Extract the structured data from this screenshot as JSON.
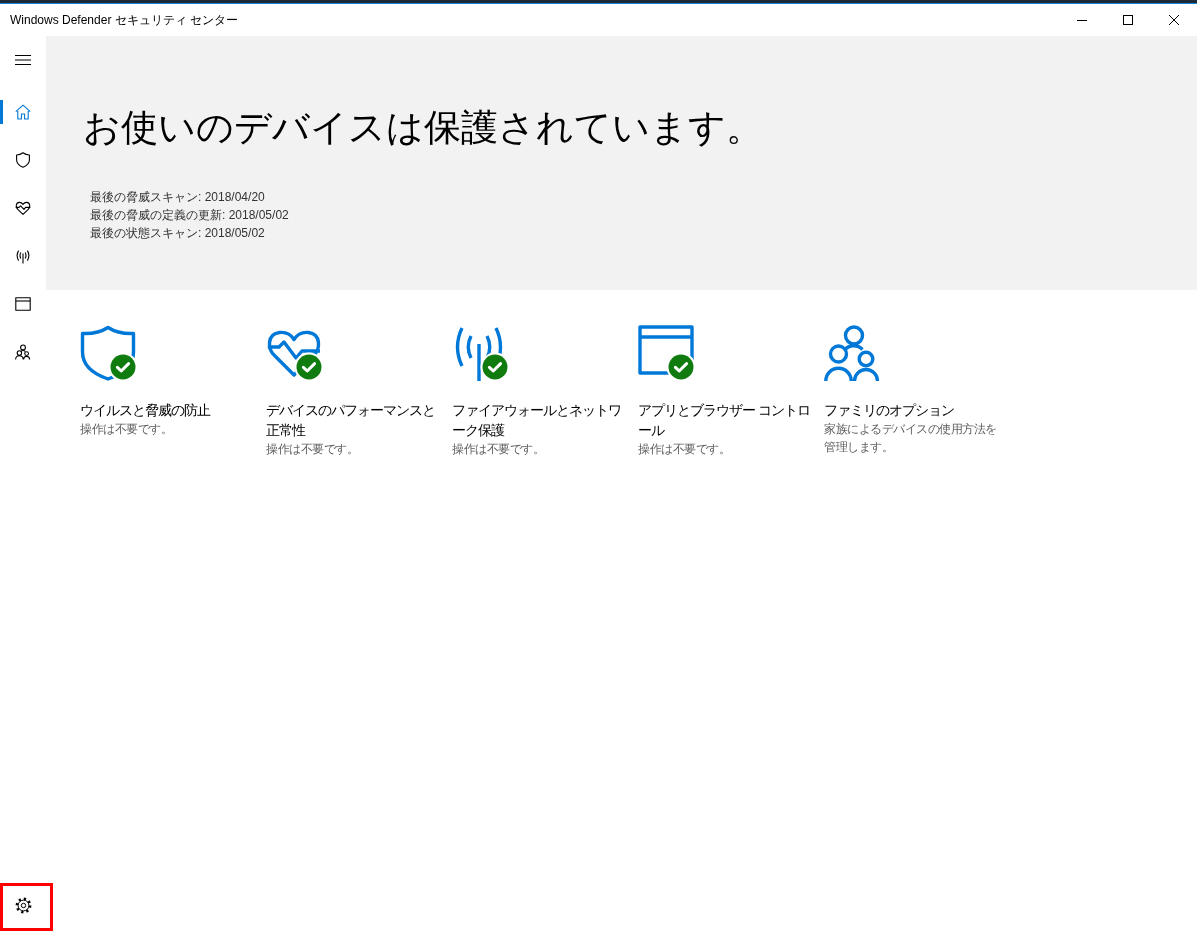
{
  "window": {
    "title": "Windows Defender セキュリティ センター"
  },
  "nav": {
    "items": [
      {
        "selected": true
      },
      {
        "selected": false
      },
      {
        "selected": false
      },
      {
        "selected": false
      },
      {
        "selected": false
      },
      {
        "selected": false
      }
    ],
    "settings": {
      "highlighted": true
    }
  },
  "hero": {
    "headline": "お使いのデバイスは保護されています。",
    "scans": [
      "最後の脅威スキャン: 2018/04/20",
      "最後の脅威の定義の更新: 2018/05/02",
      "最後の状態スキャン: 2018/05/02"
    ]
  },
  "tiles": [
    {
      "title": "ウイルスと脅威の防止",
      "subtitle": "操作は不要です。",
      "ok": true
    },
    {
      "title": "デバイスのパフォーマンスと正常性",
      "subtitle": "操作は不要です。",
      "ok": true
    },
    {
      "title": "ファイアウォールとネットワーク保護",
      "subtitle": "操作は不要です。",
      "ok": true
    },
    {
      "title": "アプリとブラウザー コントロール",
      "subtitle": "操作は不要です。",
      "ok": true
    },
    {
      "title": "ファミリのオプション",
      "subtitle": "家族によるデバイスの使用方法を管理します。",
      "ok": false
    }
  ]
}
